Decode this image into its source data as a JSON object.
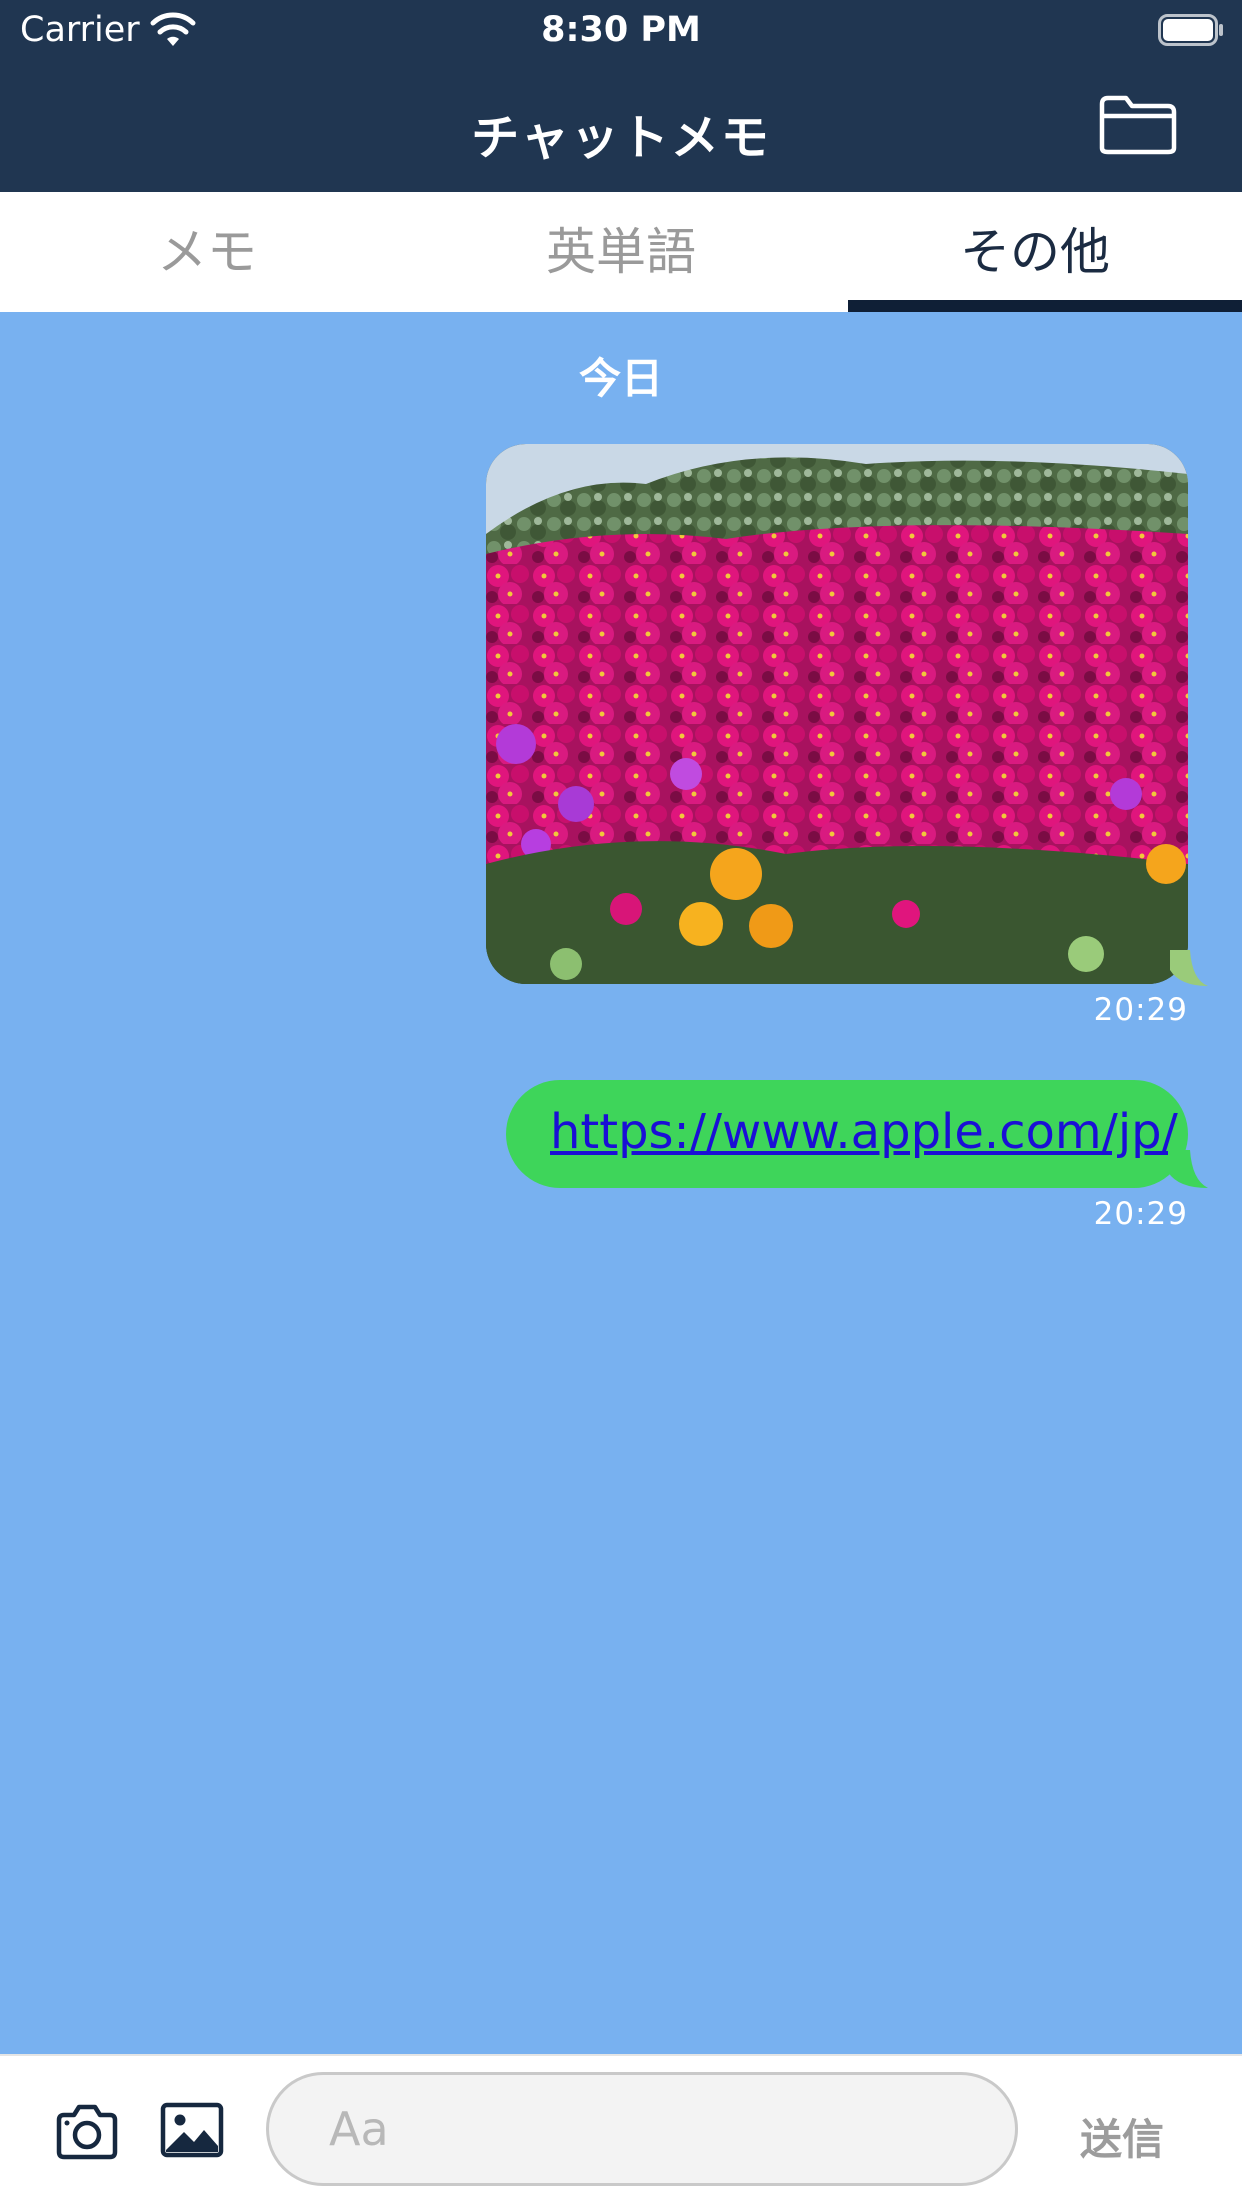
{
  "status_bar": {
    "carrier": "Carrier",
    "time": "8:30 PM"
  },
  "nav": {
    "title": "チャットメモ",
    "folder_icon": "folder-icon"
  },
  "tabs": [
    {
      "label": "メモ",
      "selected": false
    },
    {
      "label": "英単語",
      "selected": false
    },
    {
      "label": "その他",
      "selected": true
    }
  ],
  "chat": {
    "date_label": "今日",
    "messages": [
      {
        "type": "image",
        "content": "flower-photo",
        "time": "20:29"
      },
      {
        "type": "link",
        "text": "https://www.apple.com/jp/",
        "time": "20:29"
      }
    ]
  },
  "input_bar": {
    "camera_icon": "camera-icon",
    "image_icon": "photo-library-icon",
    "placeholder": "Aa",
    "value": "",
    "send_label": "送信"
  },
  "colors": {
    "nav_background": "#203651",
    "chat_background": "#78b1f0",
    "bubble_green": "#3ed55a",
    "link_color": "#1a0fd6",
    "tab_indicator": "#0f1f36"
  }
}
